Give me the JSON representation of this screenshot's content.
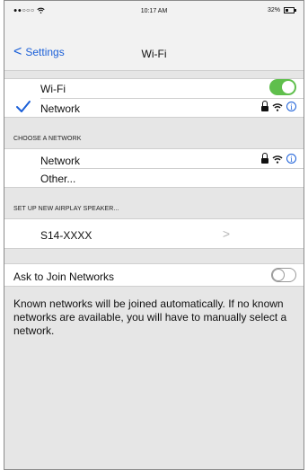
{
  "status_bar": {
    "signal": "●●○○○",
    "time": "10:17 AM",
    "battery": "32%"
  },
  "nav": {
    "back_label": "Settings",
    "title": "Wi-Fi"
  },
  "wifi_section": {
    "wifi_label": "Wi-Fi",
    "wifi_enabled": true,
    "connected_network": "Network"
  },
  "choose_network": {
    "header": "CHOOSE A NETWORK",
    "networks": [
      {
        "name": "Network"
      }
    ],
    "other_label": "Other..."
  },
  "airplay": {
    "header": "SET UP NEW AIRPLAY SPEAKER...",
    "device": "S14-XXXX"
  },
  "ask_join": {
    "label": "Ask to Join Networks",
    "enabled": false,
    "description": "Known networks will be joined automatically. If no known networks are available, you will have to manually select a network."
  },
  "colors": {
    "accent": "#1a5fd8",
    "toggle_on": "#5fbf4c",
    "background": "#e6e6e6"
  }
}
